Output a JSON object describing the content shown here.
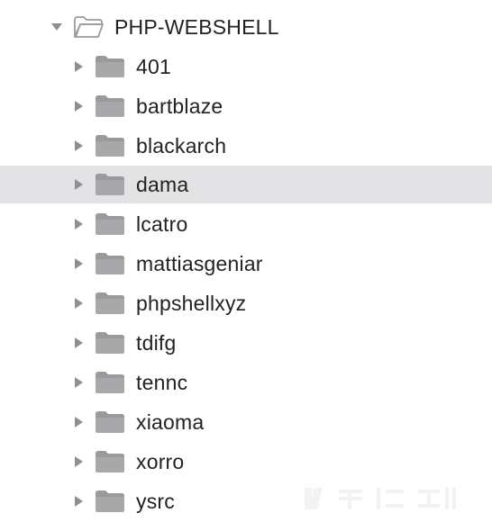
{
  "tree": {
    "root": {
      "label": "PHP-WEBSHELL",
      "expanded": true,
      "icon": "folder-open-icon"
    },
    "children": [
      {
        "label": "401",
        "expanded": false,
        "selected": false
      },
      {
        "label": "bartblaze",
        "expanded": false,
        "selected": false
      },
      {
        "label": "blackarch",
        "expanded": false,
        "selected": false
      },
      {
        "label": "dama",
        "expanded": false,
        "selected": true
      },
      {
        "label": "lcatro",
        "expanded": false,
        "selected": false
      },
      {
        "label": "mattiasgeniar",
        "expanded": false,
        "selected": false
      },
      {
        "label": "phpshellxyz",
        "expanded": false,
        "selected": false
      },
      {
        "label": "tdifg",
        "expanded": false,
        "selected": false
      },
      {
        "label": "tennc",
        "expanded": false,
        "selected": false
      },
      {
        "label": "xiaoma",
        "expanded": false,
        "selected": false
      },
      {
        "label": "xorro",
        "expanded": false,
        "selected": false
      },
      {
        "label": "ysrc",
        "expanded": false,
        "selected": false
      }
    ]
  },
  "colors": {
    "selection_background": "#e3e3e5",
    "folder_fill": "#a8a8ab",
    "folder_tab": "#9a9a9d",
    "disclosure_triangle": "#8e8e93",
    "text": "#222222"
  }
}
